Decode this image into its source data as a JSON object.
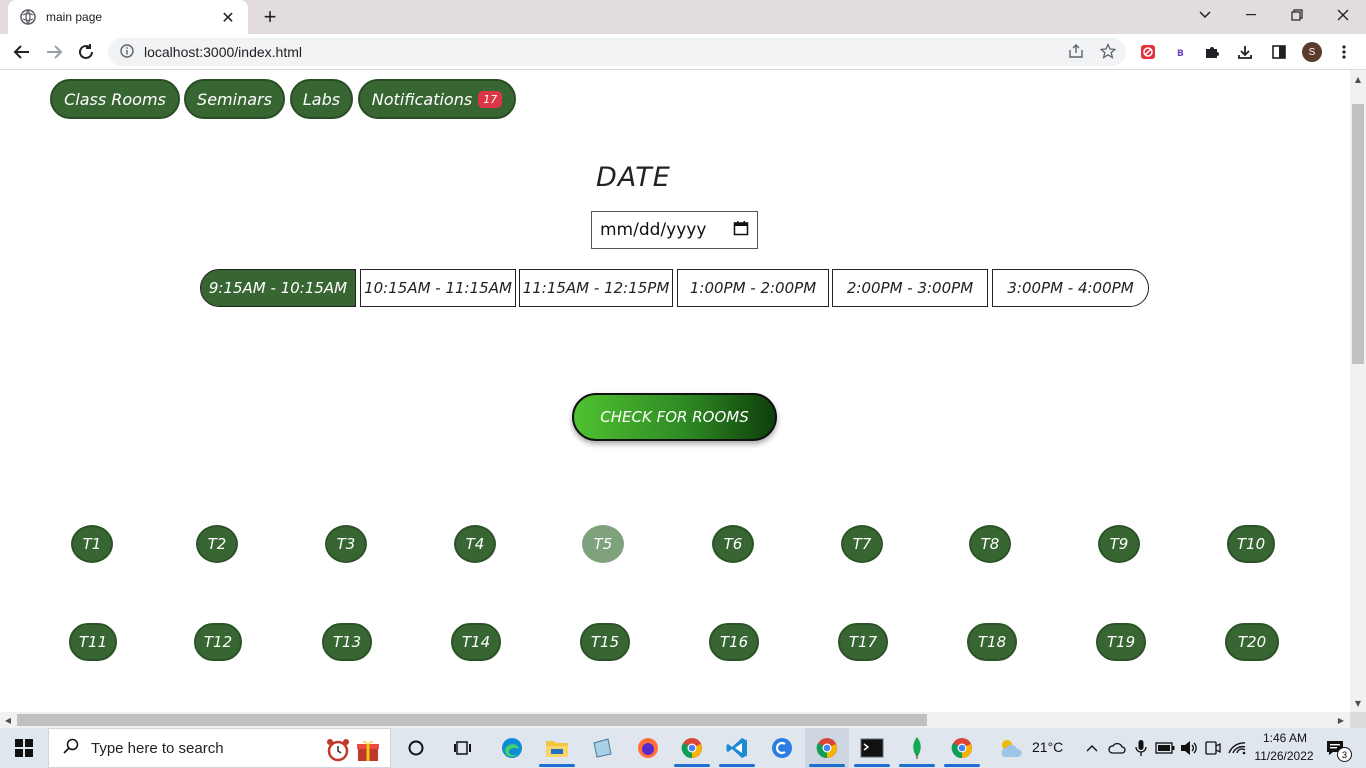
{
  "browser": {
    "tab_title": "main page",
    "url": "localhost:3000/index.html",
    "profile_initial": "S"
  },
  "nav": {
    "class_rooms": "Class Rooms",
    "seminars": "Seminars",
    "labs": "Labs",
    "notifications": "Notifications",
    "notifications_count": "17"
  },
  "form": {
    "date_heading": "DATE",
    "date_placeholder": "mm/dd/yyyy",
    "slots": [
      "9:15AM - 10:15AM",
      "10:15AM - 11:15AM",
      "11:15AM - 12:15PM",
      "1:00PM - 2:00PM",
      "2:00PM - 3:00PM",
      "3:00PM - 4:00PM"
    ],
    "selected_slot": "9:15AM - 10:15AM",
    "check_button": "CHECK FOR ROOMS"
  },
  "rooms": {
    "row1": [
      "T1",
      "T2",
      "T3",
      "T4",
      "T5",
      "T6",
      "T7",
      "T8",
      "T9",
      "T10"
    ],
    "row2": [
      "T11",
      "T12",
      "T13",
      "T14",
      "T15",
      "T16",
      "T17",
      "T18",
      "T19",
      "T20"
    ],
    "unavailable": [
      "T5"
    ]
  },
  "taskbar": {
    "search_placeholder": "Type here to search",
    "weather": "21°C",
    "time": "1:46 AM",
    "date": "11/26/2022",
    "notification_count": "3"
  },
  "colors": {
    "primary_green": "#386633",
    "badge_red": "#dc3545",
    "dim_green": "#7fa27c"
  }
}
